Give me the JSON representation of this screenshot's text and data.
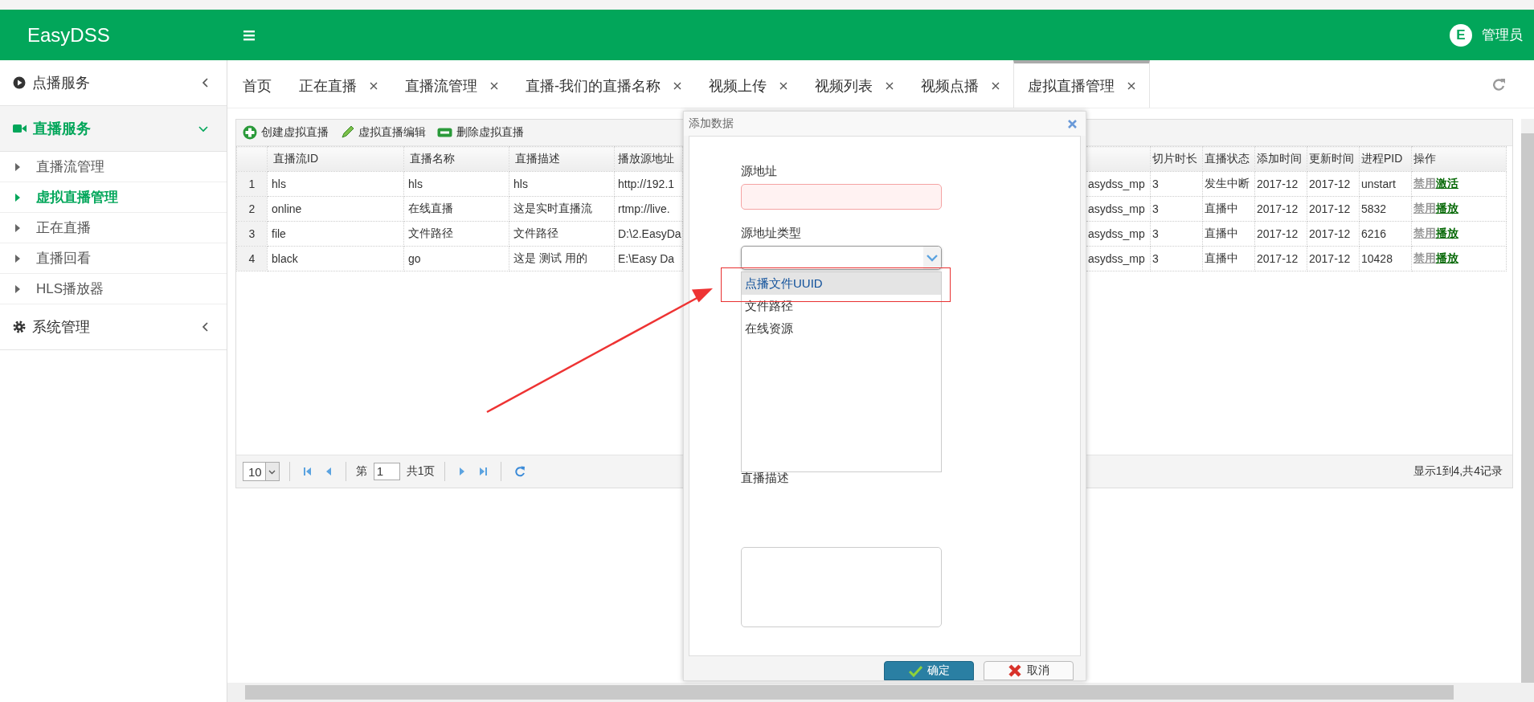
{
  "header": {
    "brand": "EasyDSS",
    "avatar_letter": "E",
    "user": "管理员"
  },
  "sidebar": {
    "sections": [
      {
        "kind": "play",
        "label": "点播服务",
        "expanded": false
      },
      {
        "kind": "camera",
        "label": "直播服务",
        "expanded": true,
        "items": [
          {
            "label": "直播流管理",
            "selected": false
          },
          {
            "label": "虚拟直播管理",
            "selected": true
          },
          {
            "label": "正在直播",
            "selected": false
          },
          {
            "label": "直播回看",
            "selected": false
          },
          {
            "label": "HLS播放器",
            "selected": false
          }
        ]
      },
      {
        "kind": "gear",
        "label": "系统管理",
        "expanded": false
      }
    ]
  },
  "tabs": [
    {
      "label": "首页",
      "closable": false,
      "selected": false
    },
    {
      "label": "正在直播",
      "closable": true,
      "selected": false
    },
    {
      "label": "直播流管理",
      "closable": true,
      "selected": false
    },
    {
      "label": "直播-我们的直播名称",
      "closable": true,
      "selected": false
    },
    {
      "label": "视频上传",
      "closable": true,
      "selected": false
    },
    {
      "label": "视频列表",
      "closable": true,
      "selected": false
    },
    {
      "label": "视频点播",
      "closable": true,
      "selected": false
    },
    {
      "label": "虚拟直播管理",
      "closable": true,
      "selected": true
    }
  ],
  "toolbar": [
    {
      "kind": "add",
      "label": "创建虚拟直播"
    },
    {
      "kind": "edit",
      "label": "虚拟直播编辑"
    },
    {
      "kind": "delete",
      "label": "删除虚拟直播"
    }
  ],
  "table": {
    "left_columns": [
      "直播流ID",
      "直播名称",
      "直播描述",
      "播放源地址"
    ],
    "right_columns": [
      "切片时长",
      "直播状态",
      "添加时间",
      "更新时间",
      "进程PID",
      "操作"
    ],
    "rows": [
      {
        "index": "1",
        "left_cells": [
          "hls",
          "hls",
          "hls",
          "http://192.1"
        ],
        "column_6": "asydss_mp",
        "right_cells": [
          "3",
          "发生中断",
          "2017-12",
          "2017-12",
          "unstart"
        ],
        "disable_link": "禁用",
        "action_link": "激活"
      },
      {
        "index": "2",
        "left_cells": [
          "online",
          "在线直播",
          "这是实时直播流",
          "rtmp://live."
        ],
        "column_6": "asydss_mp",
        "right_cells": [
          "3",
          "直播中",
          "2017-12",
          "2017-12",
          "5832"
        ],
        "disable_link": "禁用",
        "action_link": "播放"
      },
      {
        "index": "3",
        "left_cells": [
          "file",
          "文件路径",
          "文件路径",
          "D:\\2.EasyDa"
        ],
        "column_6": "asydss_mp",
        "right_cells": [
          "3",
          "直播中",
          "2017-12",
          "2017-12",
          "6216"
        ],
        "disable_link": "禁用",
        "action_link": "播放"
      },
      {
        "index": "4",
        "left_cells": [
          "black",
          "go",
          "这是 测试 用的",
          "E:\\Easy Da"
        ],
        "column_6": "asydss_mp",
        "right_cells": [
          "3",
          "直播中",
          "2017-12",
          "2017-12",
          "10428"
        ],
        "disable_link": "禁用",
        "action_link": "播放"
      }
    ]
  },
  "pager": {
    "page_size": "10",
    "page_prefix": "第",
    "page": "1",
    "page_total": "共1页",
    "summary": "显示1到4,共4记录"
  },
  "dialog": {
    "title": "添加数据",
    "fields": [
      {
        "kind": "text",
        "label": "源地址",
        "invalid": true
      },
      {
        "kind": "combo",
        "label": "源地址类型",
        "expanded": true,
        "options": [
          {
            "label": "点播文件UUID",
            "selected": true
          },
          {
            "label": "文件路径",
            "selected": false
          },
          {
            "label": "在线资源",
            "selected": false
          }
        ]
      },
      {
        "kind": "textarea",
        "label": "直播描述"
      }
    ],
    "buttons": [
      {
        "kind": "ok",
        "label": "确定"
      },
      {
        "kind": "cancel",
        "label": "取消"
      }
    ]
  },
  "annotations": [
    {
      "kind": "box"
    },
    {
      "kind": "arrow"
    }
  ]
}
